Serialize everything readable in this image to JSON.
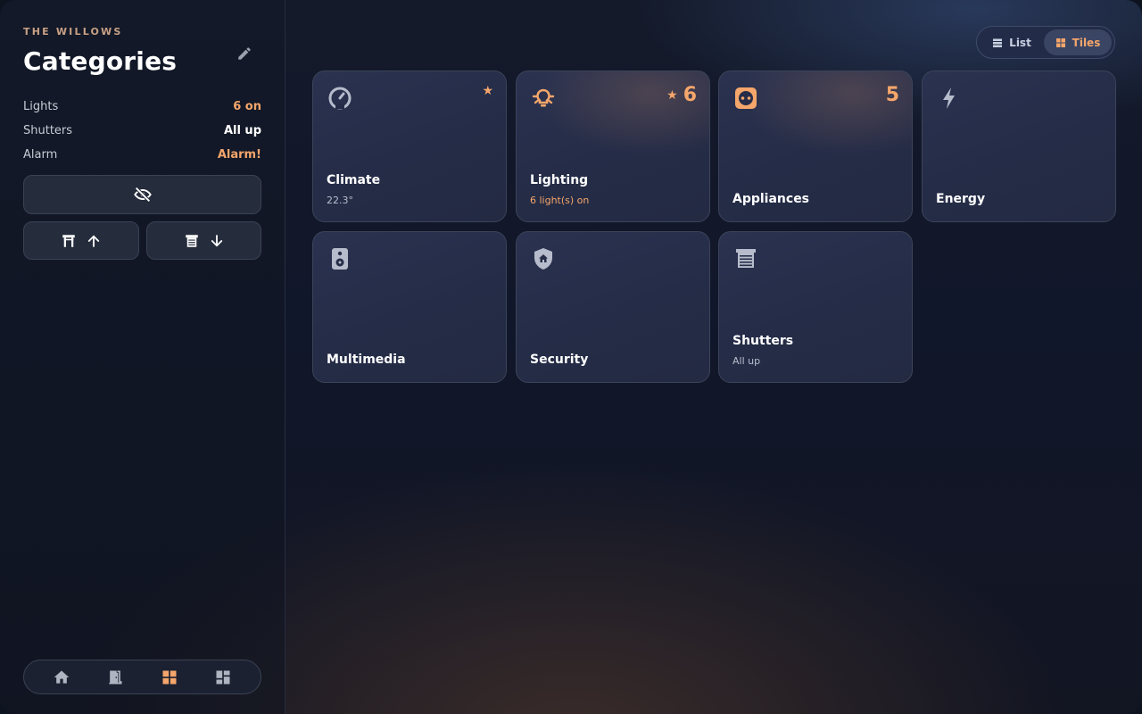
{
  "sidebar": {
    "home_name": "THE WILLOWS",
    "title": "Categories",
    "edit_icon": "pencil-icon",
    "stats": [
      {
        "label": "Lights",
        "value": "6 on"
      },
      {
        "label": "Shutters",
        "value": "All up"
      },
      {
        "label": "Alarm",
        "value": "Alarm!"
      }
    ],
    "actions": {
      "hide_icon": "eye-off-icon",
      "shutters_up_icons": [
        "shutter-icon",
        "arrow-up-icon"
      ],
      "shutters_down_icons": [
        "shutter-closed-icon",
        "arrow-down-icon"
      ]
    },
    "nav": [
      {
        "icon": "home-icon",
        "active": false
      },
      {
        "icon": "door-icon",
        "active": false
      },
      {
        "icon": "grid-icon",
        "active": true
      },
      {
        "icon": "dashboard-icon",
        "active": false
      }
    ]
  },
  "view_toggle": {
    "list_label": "List",
    "tiles_label": "Tiles",
    "selected": "Tiles"
  },
  "tiles": [
    {
      "name": "Climate",
      "subtitle": "22.3°",
      "icon": "thermostat-icon",
      "favorite": true,
      "count": ""
    },
    {
      "name": "Lighting",
      "subtitle": "6 light(s) on",
      "icon": "light-bulb-icon",
      "favorite": true,
      "count": "6"
    },
    {
      "name": "Appliances",
      "subtitle": "",
      "icon": "socket-icon",
      "favorite": false,
      "count": "5"
    },
    {
      "name": "Energy",
      "subtitle": "",
      "icon": "lightning-icon",
      "favorite": false,
      "count": ""
    },
    {
      "name": "Multimedia",
      "subtitle": "",
      "icon": "speaker-icon",
      "favorite": false,
      "count": ""
    },
    {
      "name": "Security",
      "subtitle": "",
      "icon": "shield-home-icon",
      "favorite": false,
      "count": ""
    },
    {
      "name": "Shutters",
      "subtitle": "All up",
      "icon": "shutter-icon",
      "favorite": false,
      "count": ""
    }
  ],
  "colors": {
    "accent": "#f5a66b",
    "tile_bg": "#262d48",
    "sidebar_bg": "#141a2a"
  }
}
